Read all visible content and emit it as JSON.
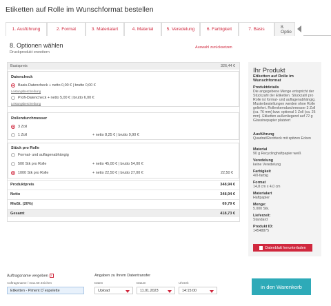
{
  "page_title": "Etiketten auf Rolle im Wunschformat bestellen",
  "tabs": [
    {
      "label": "1. Ausführung"
    },
    {
      "label": "2. Format"
    },
    {
      "label": "3. Materialart"
    },
    {
      "label": "4. Material"
    },
    {
      "label": "5. Veredelung"
    },
    {
      "label": "6. Farbigkeit"
    },
    {
      "label": "7. Basis"
    },
    {
      "label": "8. Optio"
    }
  ],
  "step": {
    "title": "8. Optionen wählen",
    "subtitle": "Druckprodukt erweitern",
    "reset_label": "Auswahl zurücksetzen"
  },
  "config": {
    "basispreis": {
      "label": "Basispreis",
      "value": "326,44 €"
    },
    "datencheck": {
      "title": "Datencheck",
      "options": [
        {
          "label": "Basis-Datencheck + netto 0,00 € | brutto 0,00 €",
          "link": "Leistungsbeschreibung",
          "selected": true
        },
        {
          "label": "Profi-Datencheck + netto 5,00 € | brutto 6,00 €",
          "link": "Leistungsbeschreibung",
          "selected": false
        }
      ]
    },
    "rollendurchmesser": {
      "title": "Rollendurchmesser",
      "options": [
        {
          "label": "3 Zoll",
          "price": "",
          "selected": true
        },
        {
          "label": "1 Zoll",
          "price": "+ netto 8,25 € | brutto 9,90 €",
          "selected": false
        }
      ]
    },
    "stueck": {
      "title": "Stück pro Rolle",
      "options": [
        {
          "label": "Format- und auflagenabhängig",
          "price": "",
          "right": "",
          "selected": false
        },
        {
          "label": "500 Stk pro Rolle",
          "price": "+ netto 45,00 € | brutto 54,00 €",
          "right": "",
          "selected": false
        },
        {
          "label": "1000 Stk pro Rolle",
          "price": "+ netto 22,50 € | brutto 27,00 €",
          "right": "22,50 €",
          "selected": true
        }
      ]
    },
    "summary": [
      {
        "label": "Produktpreis",
        "value": "348,94 €"
      },
      {
        "label": "Netto",
        "value": "348,94 €"
      },
      {
        "label": "MwSt. (20%)",
        "value": "69,79 €"
      },
      {
        "label": "Gesamt",
        "value": "418,73 €"
      }
    ]
  },
  "sidebar": {
    "title": "Ihr Produkt",
    "product_name": "Etiketten auf Rolle im Wunschformat",
    "sections": [
      {
        "heading": "Produktdetails",
        "text": "Die angegebene Menge entspricht der Stückzahl der Etiketten. Stückzahl pro Rolle ist format- und auflagenabhängig. Musterbestellungen werden ohne Rolle geliefert. Rollenkerndurchmesser 3 Zoll (ca. 76 mm) bzw. optional 1 Zoll (ca. 25 mm). Etiketten außenliegend auf 72 g Glassinepapier platziert"
      },
      {
        "heading": "Ausführung",
        "text": "Quadrat/Rechteck mit spitzen Ecken"
      },
      {
        "heading": "Material",
        "text": "90 g Recyclinghaftpapier weiß"
      },
      {
        "heading": "Veredelung",
        "text": "keine Veredelung"
      },
      {
        "heading": "Farbigkeit",
        "text": "4/0-farbig"
      },
      {
        "heading": "Format",
        "text": "14,8 cm x 4,0 cm"
      },
      {
        "heading": "Materialart",
        "text": "Haftpapier"
      },
      {
        "heading": "Menge:",
        "text": "5.000 Stk."
      },
      {
        "heading": "Lieferzeit:",
        "text": "Standard"
      },
      {
        "heading": "Produkt ID:",
        "text": "14548875"
      }
    ],
    "download_label": "Datenblatt herunterladen"
  },
  "bottom": {
    "auftrag_title": "Auftragsname vergeben",
    "auftrag_hint": "Auftragsname / max.60 Zeichen",
    "auftrag_value": "Etiketten - Piment D´espelette",
    "transfer_title": "Angaben zu Ihrem Datentransfer",
    "daten_label": "Daten",
    "daten_value": "Upload",
    "datum_label": "Datum",
    "datum_value": "11.01.2023",
    "uhrzeit_label": "Uhrzeit",
    "uhrzeit_value": "14:15:00",
    "cart_label": "in den Warenkorb"
  },
  "colors": {
    "accent": "#d0283e",
    "cart": "#2eaab8",
    "panel": "#f3f3f3"
  }
}
